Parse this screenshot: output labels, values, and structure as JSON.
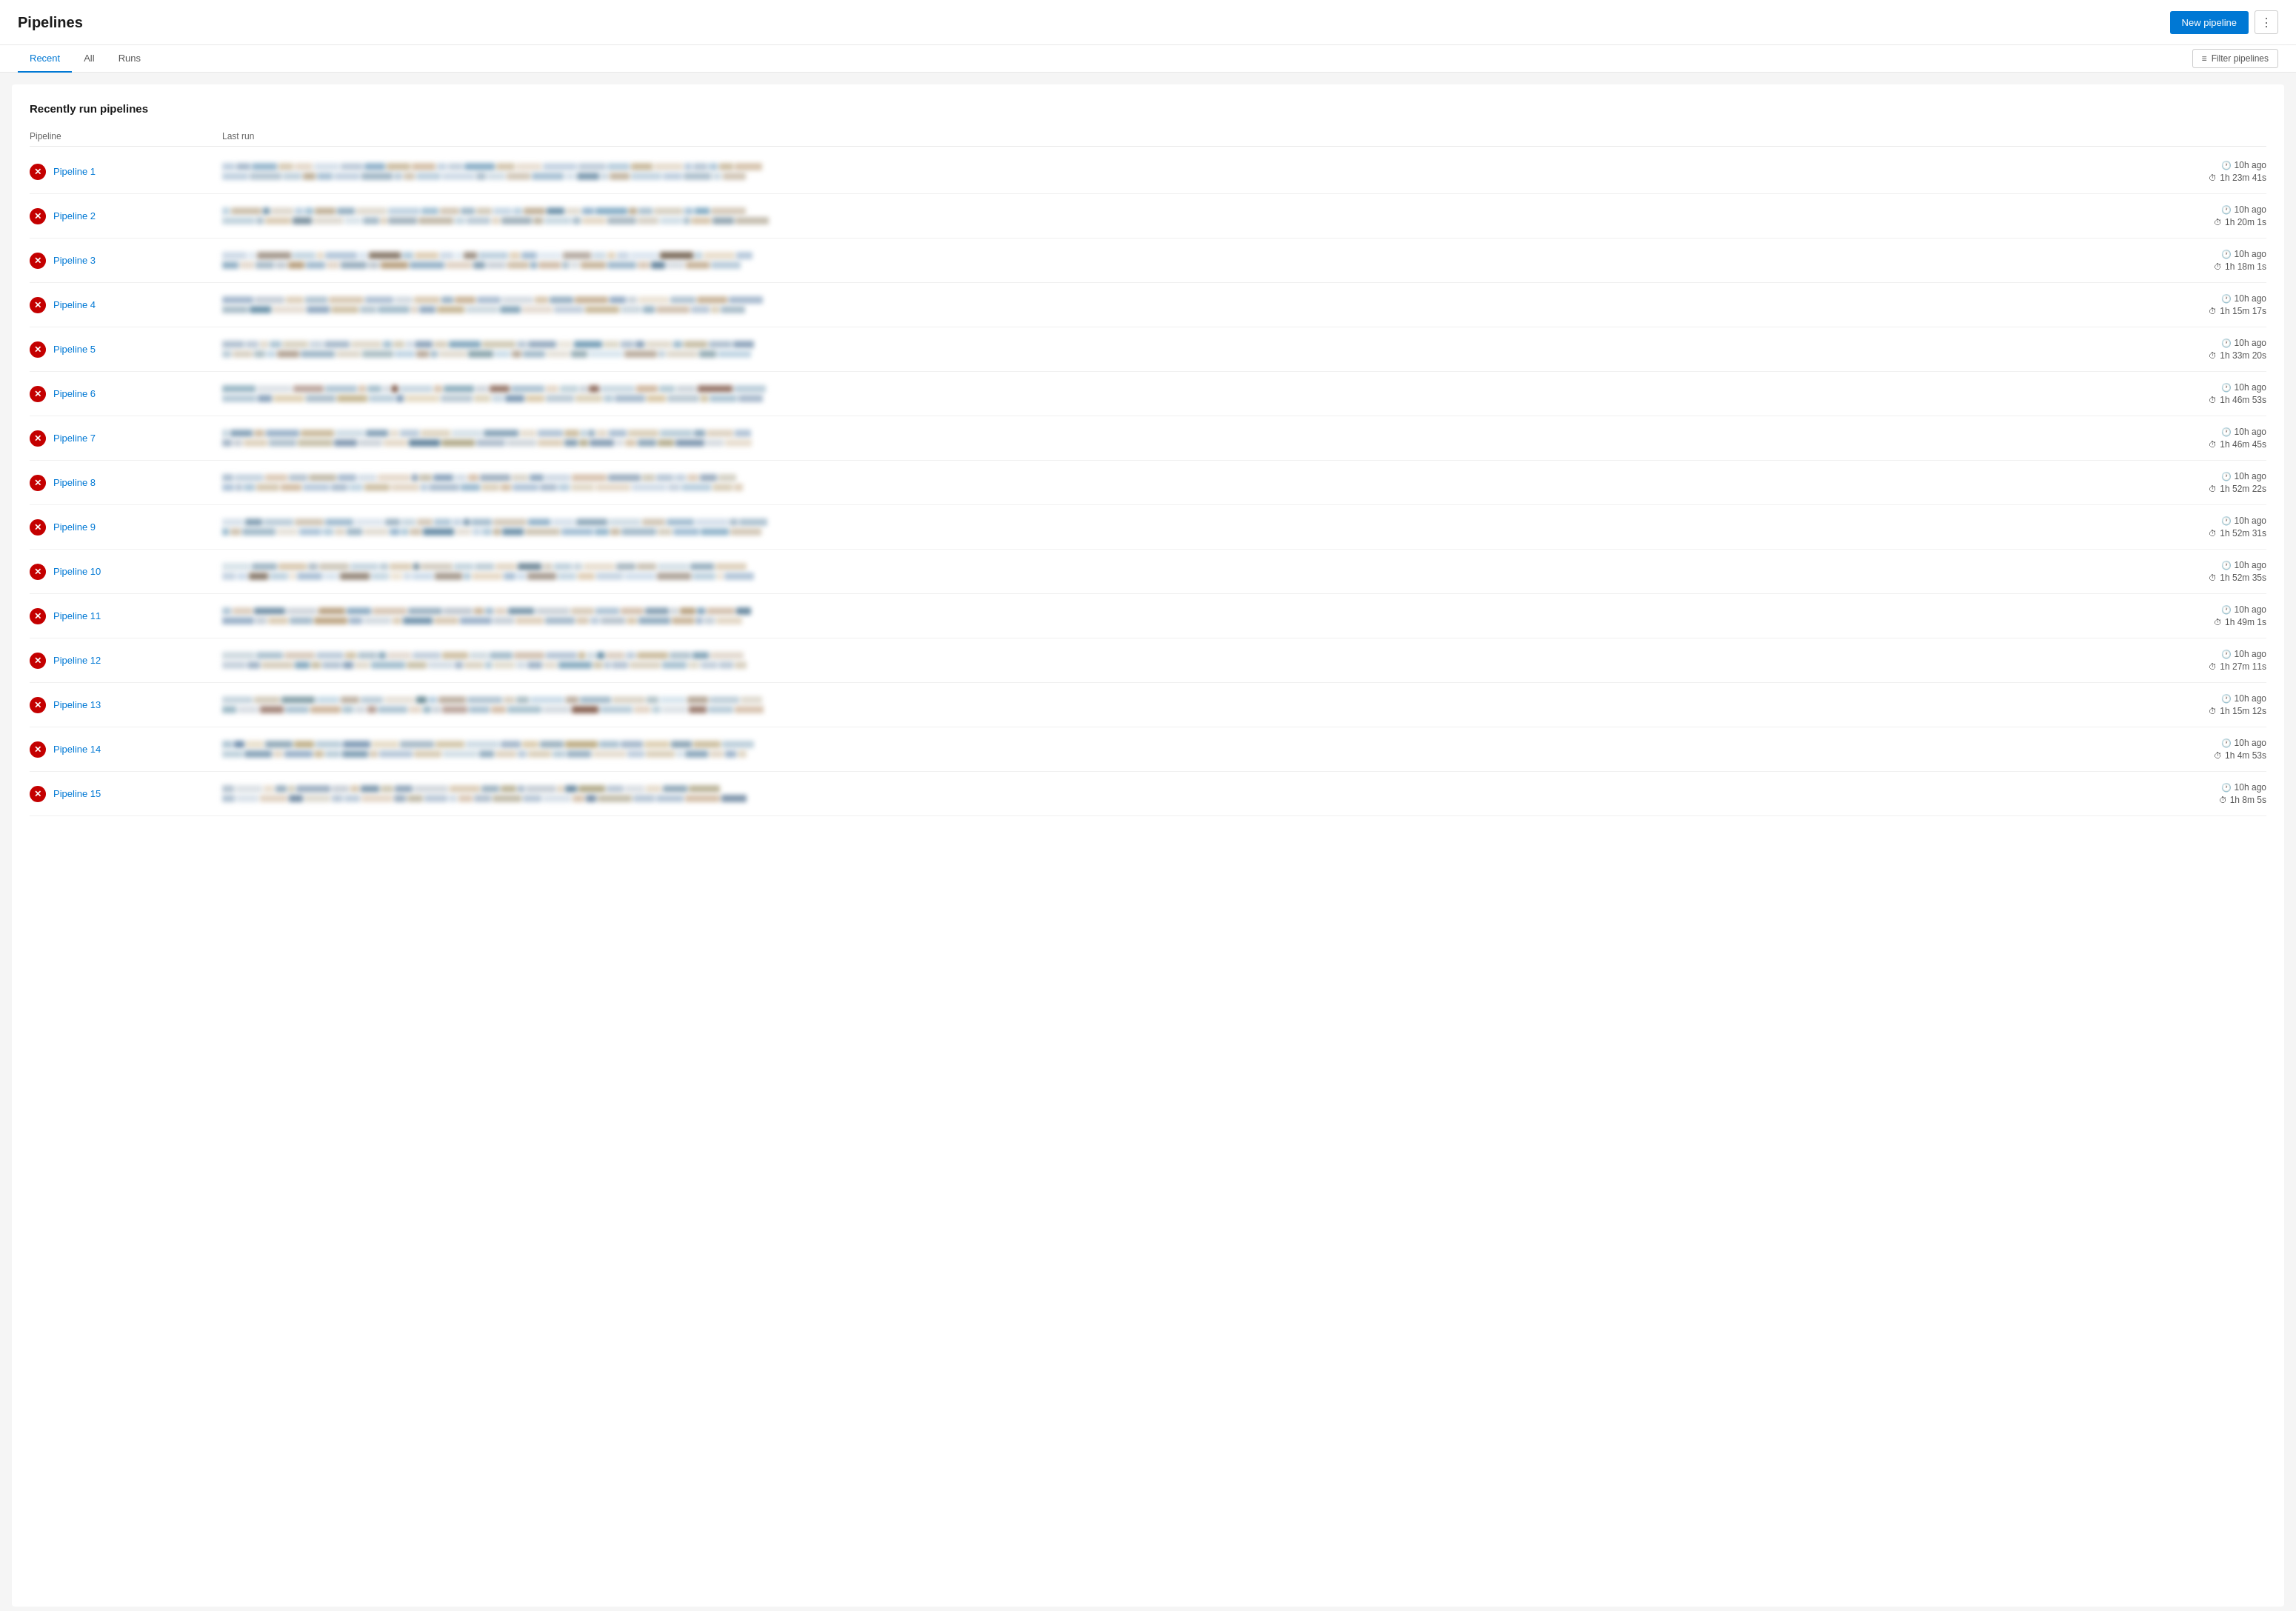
{
  "header": {
    "title": "Pipelines",
    "new_pipeline_label": "New pipeline",
    "more_icon": "⋮"
  },
  "tabs": {
    "items": [
      {
        "label": "Recent",
        "active": true
      },
      {
        "label": "All",
        "active": false
      },
      {
        "label": "Runs",
        "active": false
      }
    ],
    "filter_label": "Filter pipelines"
  },
  "section": {
    "title": "Recently run pipelines",
    "table_headers": [
      "Pipeline",
      "Last run",
      ""
    ]
  },
  "pipelines": [
    {
      "name": "Pipeline 1",
      "time_ago": "10h ago",
      "duration": "1h 23m 41s"
    },
    {
      "name": "Pipeline 2",
      "time_ago": "10h ago",
      "duration": "1h 20m 1s"
    },
    {
      "name": "Pipeline 3",
      "time_ago": "10h ago",
      "duration": "1h 18m 1s"
    },
    {
      "name": "Pipeline 4",
      "time_ago": "10h ago",
      "duration": "1h 15m 17s"
    },
    {
      "name": "Pipeline 5",
      "time_ago": "10h ago",
      "duration": "1h 33m 20s"
    },
    {
      "name": "Pipeline 6",
      "time_ago": "10h ago",
      "duration": "1h 46m 53s"
    },
    {
      "name": "Pipeline 7",
      "time_ago": "10h ago",
      "duration": "1h 46m 45s"
    },
    {
      "name": "Pipeline 8",
      "time_ago": "10h ago",
      "duration": "1h 52m 22s"
    },
    {
      "name": "Pipeline 9",
      "time_ago": "10h ago",
      "duration": "1h 52m 31s"
    },
    {
      "name": "Pipeline 10",
      "time_ago": "10h ago",
      "duration": "1h 52m 35s"
    },
    {
      "name": "Pipeline 11",
      "time_ago": "10h ago",
      "duration": "1h 49m 1s"
    },
    {
      "name": "Pipeline 12",
      "time_ago": "10h ago",
      "duration": "1h 27m 11s"
    },
    {
      "name": "Pipeline 13",
      "time_ago": "10h ago",
      "duration": "1h 15m 12s"
    },
    {
      "name": "Pipeline 14",
      "time_ago": "10h ago",
      "duration": "1h 4m 53s"
    },
    {
      "name": "Pipeline 15",
      "time_ago": "10h ago",
      "duration": "1h 8m 5s"
    }
  ],
  "colors": {
    "accent": "#0078d4",
    "fail": "#c40000",
    "bar_colors": [
      "#b0c4d8",
      "#c8b89a",
      "#8bafc8",
      "#d4c0a8",
      "#6a98b8",
      "#aac0d0",
      "#e8d8c0",
      "#9ab4c8",
      "#c0a888",
      "#7090a8",
      "#d0c0b0",
      "#88a8c0",
      "#bca890"
    ]
  }
}
